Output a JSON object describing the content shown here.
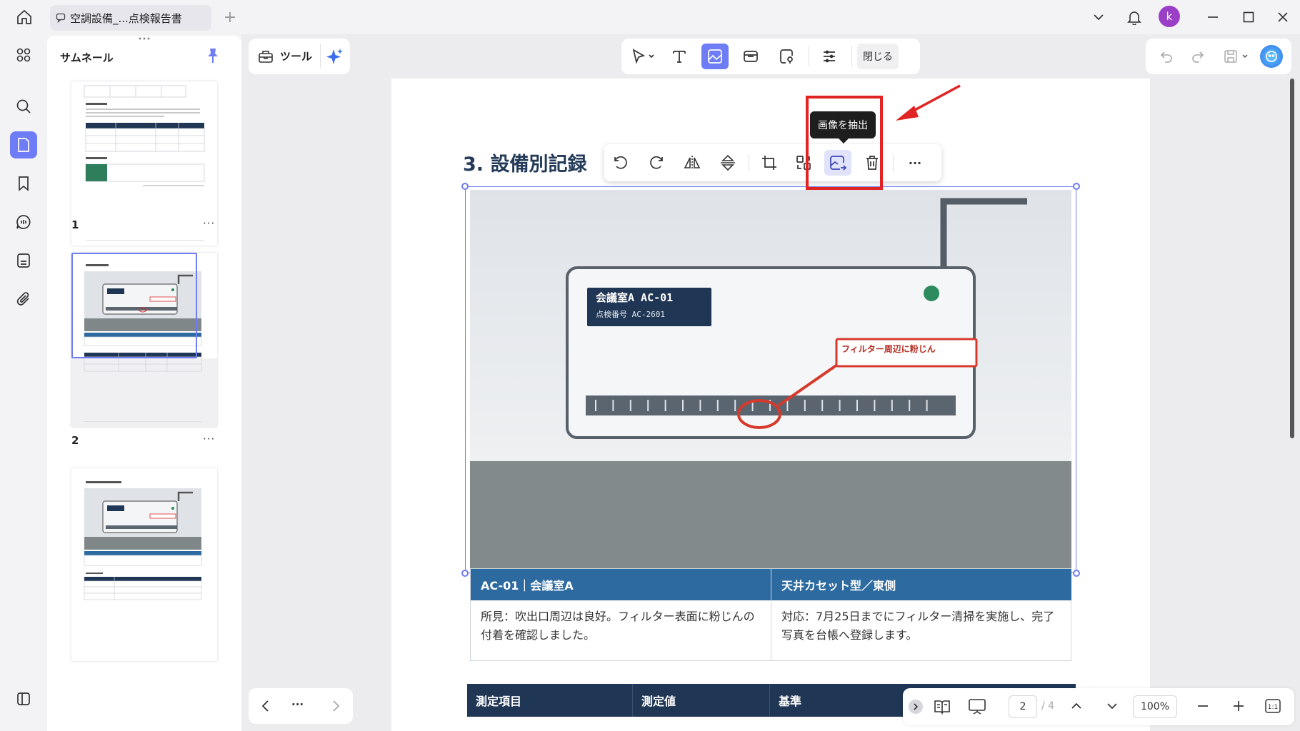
{
  "titlebar": {
    "tab_title": "空調設備_...点検報告書",
    "avatar_letter": "k"
  },
  "thumbnails": {
    "title": "サムネール",
    "pages": [
      {
        "number": "1"
      },
      {
        "number": "2"
      }
    ],
    "more": "···"
  },
  "tools": {
    "label": "ツール",
    "close_label": "閉じる"
  },
  "document": {
    "section_title": "3.  設備別記録",
    "image": {
      "label_title": "会議室A AC-01",
      "label_sub": "点検番号 AC-2601",
      "callout": "フィルター周辺に粉じん"
    },
    "caption": {
      "left_head": "AC-01｜会議室A",
      "right_head": "天井カセット型／東側",
      "left_body": "所見：吹出口周辺は良好。フィルター表面に粉じんの付着を確認しました。",
      "right_body": "対応：7月25日までにフィルター清掃を実施し、完了写真を台帳へ登録します。"
    },
    "measure_headers": [
      "測定項目",
      "測定値",
      "基準"
    ]
  },
  "tooltip": "画像を抽出",
  "pager": {
    "current": "2",
    "total": "/ 4",
    "zoom": "100%",
    "nav_more": "···"
  },
  "colors": {
    "accent": "#6e7cf5",
    "annotation_red": "#e02424",
    "caption_blue": "#2c6aa0",
    "table_navy": "#1f3654"
  }
}
